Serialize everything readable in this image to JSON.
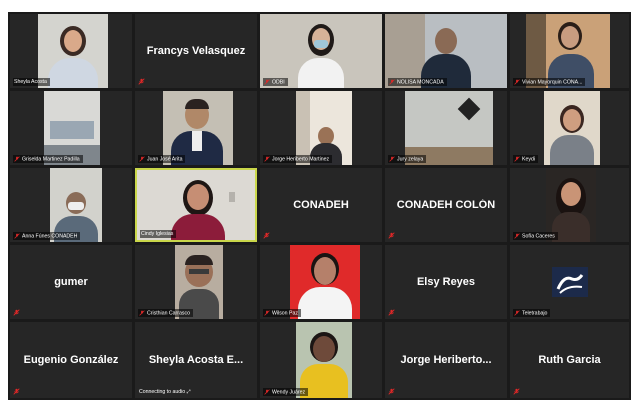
{
  "tiles": [
    {
      "name": "Sheyla Acosta",
      "video": true
    },
    {
      "name": "Francys Velasquez",
      "video": false
    },
    {
      "name": "ODBI",
      "video": true
    },
    {
      "name": "NOLISA MONCADA",
      "video": true
    },
    {
      "name": "Vivian Mayorquin CONA...",
      "video": true
    },
    {
      "name": "Griselda Martinez Padilla",
      "video": true
    },
    {
      "name": "Juan José Arita",
      "video": true
    },
    {
      "name": "Jorge Heriberto Martinez",
      "video": true
    },
    {
      "name": "Jury zelaya",
      "video": true
    },
    {
      "name": "Keydi",
      "video": true
    },
    {
      "name": "Anna Fúnes CONADEH",
      "video": true
    },
    {
      "name": "Cindy Iglesias",
      "video": true,
      "active_speaker": true
    },
    {
      "name": "CONADEH",
      "video": false
    },
    {
      "name": "CONADEH COLÓN",
      "video": false
    },
    {
      "name": "Sofía Caceres",
      "video": true
    },
    {
      "name": "gumer",
      "video": false
    },
    {
      "name": "Cristhian Carrasco",
      "video": true
    },
    {
      "name": "Wilson Paz",
      "video": true
    },
    {
      "name": "Elsy Reyes",
      "video": false
    },
    {
      "name": "Teletrabajo",
      "video": true
    },
    {
      "name": "Eugenio González",
      "video": false
    },
    {
      "name": "Sheyla Acosta E...",
      "video": false,
      "status": "Connecting to audio"
    },
    {
      "name": "Wendy Juárez",
      "video": true
    },
    {
      "name": "Jorge Heriberto...",
      "video": false
    },
    {
      "name": "Ruth Garcia",
      "video": false
    }
  ],
  "colors": {
    "gallery_bg": "#1a1a1a",
    "tile_bg": "#262626",
    "active_border": "#c9d64a",
    "muted_icon": "#e02828"
  }
}
